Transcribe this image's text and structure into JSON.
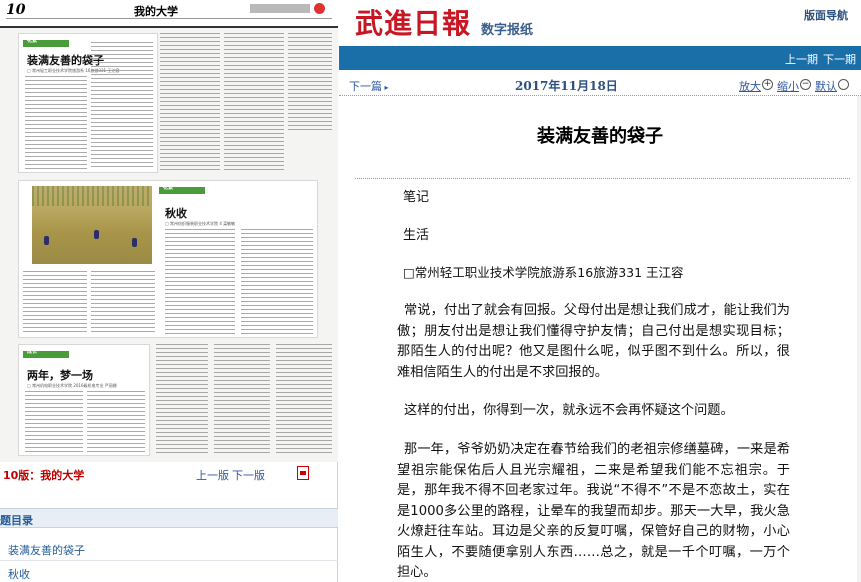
{
  "left": {
    "page_num": "10",
    "page_title": "我的大学",
    "articles": [
      {
        "tag": "花絮",
        "title": "装满友善的袋子",
        "author": "□ 常州轻工职业技术学院旅游系 16旅游331 王江容"
      },
      {
        "tag": "花絮",
        "title": "秋收",
        "author": "□ 常州纺织服装职业技术学院 4 栾敏敏"
      },
      {
        "tag": "成长",
        "title": "两年，梦一场",
        "author": "□ 常州机电职业技术学院 2016级机电专业 严丽娜"
      }
    ],
    "version_label": "10版：我的大学",
    "prev_version": "上一版",
    "next_version": "下一版",
    "directory_title": "题目录",
    "directory_items": [
      "装满友善的袋子",
      "秋收"
    ]
  },
  "header": {
    "logo": "武進日報",
    "subtitle": "数字报纸",
    "nav": "版面导航"
  },
  "bar": {
    "prev_issue": "上一期",
    "next_issue": "下一期"
  },
  "toolbar": {
    "next_article": "下一篇",
    "date": "2017年11月18日",
    "zoom_in": "放大",
    "zoom_out": "缩小",
    "default": "默认"
  },
  "article": {
    "title": "装满友善的袋子",
    "category1": "笔记",
    "category2": "生活",
    "author": "□常州轻工职业技术学院旅游系16旅游331 王江容",
    "p1": "常说，付出了就会有回报。父母付出是想让我们成才，能让我们为傲；朋友付出是想让我们懂得守护友情；自己付出是想实现目标；那陌生人的付出呢？他又是图什么呢，似乎图不到什么。所以，很难相信陌生人的付出是不求回报的。",
    "p2": "这样的付出，你得到一次，就永远不会再怀疑这个问题。",
    "p3": "那一年，爷爷奶奶决定在春节给我们的老祖宗修缮墓碑，一来是希望祖宗能保佑后人且光宗耀祖，二来是希望我们能不忘祖宗。于是，那年我不得不回老家过年。我说“不得不”不是不恋故土，实在是1000多公里的路程，让晕车的我望而却步。那天一大早，我火急火燎赶往车站。耳边是父亲的反复叮嘱，保管好自己的财物，小心陌生人，不要随便拿别人东西……总之，就是一千个叮嘱，一万个担心。"
  },
  "colors": {
    "logo_red": "#c81623",
    "bar_blue": "#1b6fa8",
    "link_blue": "#2c58a0",
    "version_red": "#c00000"
  }
}
